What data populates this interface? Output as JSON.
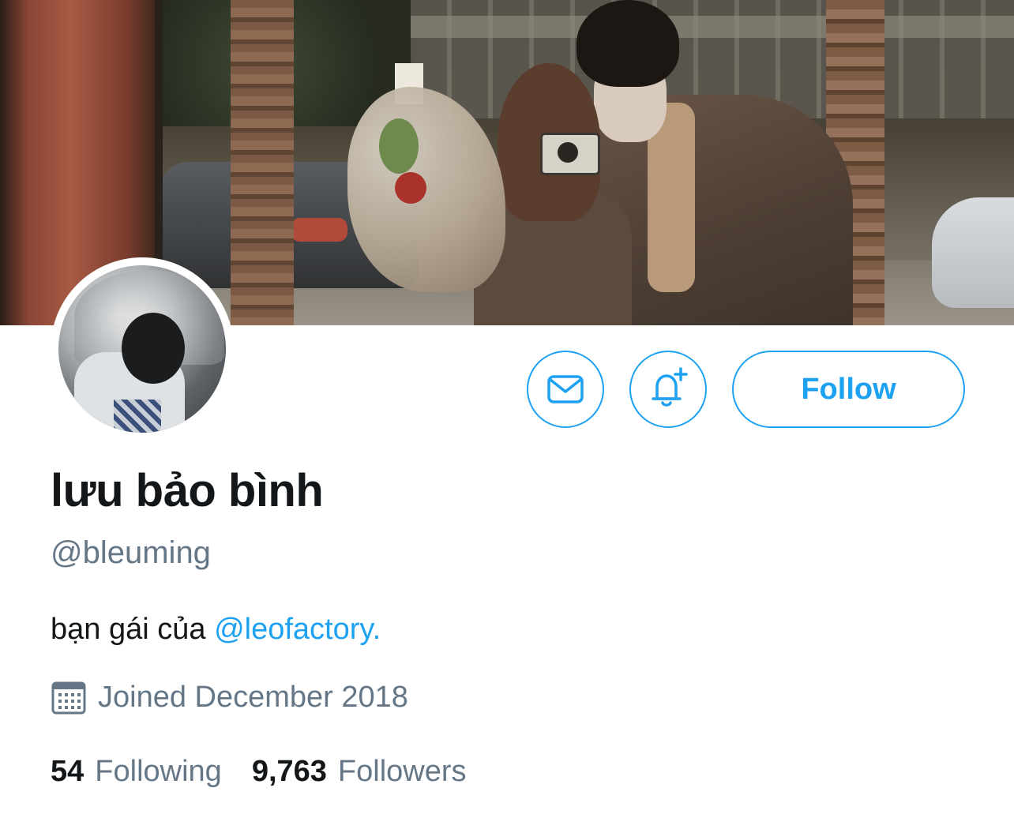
{
  "profile": {
    "display_name": "lưu bảo bình",
    "handle": "@bleuming",
    "bio_text": "bạn gái của ",
    "bio_mention": "@leofactory.",
    "joined": "Joined December 2018"
  },
  "actions": {
    "follow_label": "Follow",
    "message_icon": "mail-icon",
    "notify_icon": "bell-plus-icon"
  },
  "stats": {
    "following_count": "54",
    "following_label": "Following",
    "followers_count": "9,763",
    "followers_label": "Followers"
  },
  "colors": {
    "accent": "#1da1f2",
    "text_primary": "#14171a",
    "text_secondary": "#657786"
  }
}
